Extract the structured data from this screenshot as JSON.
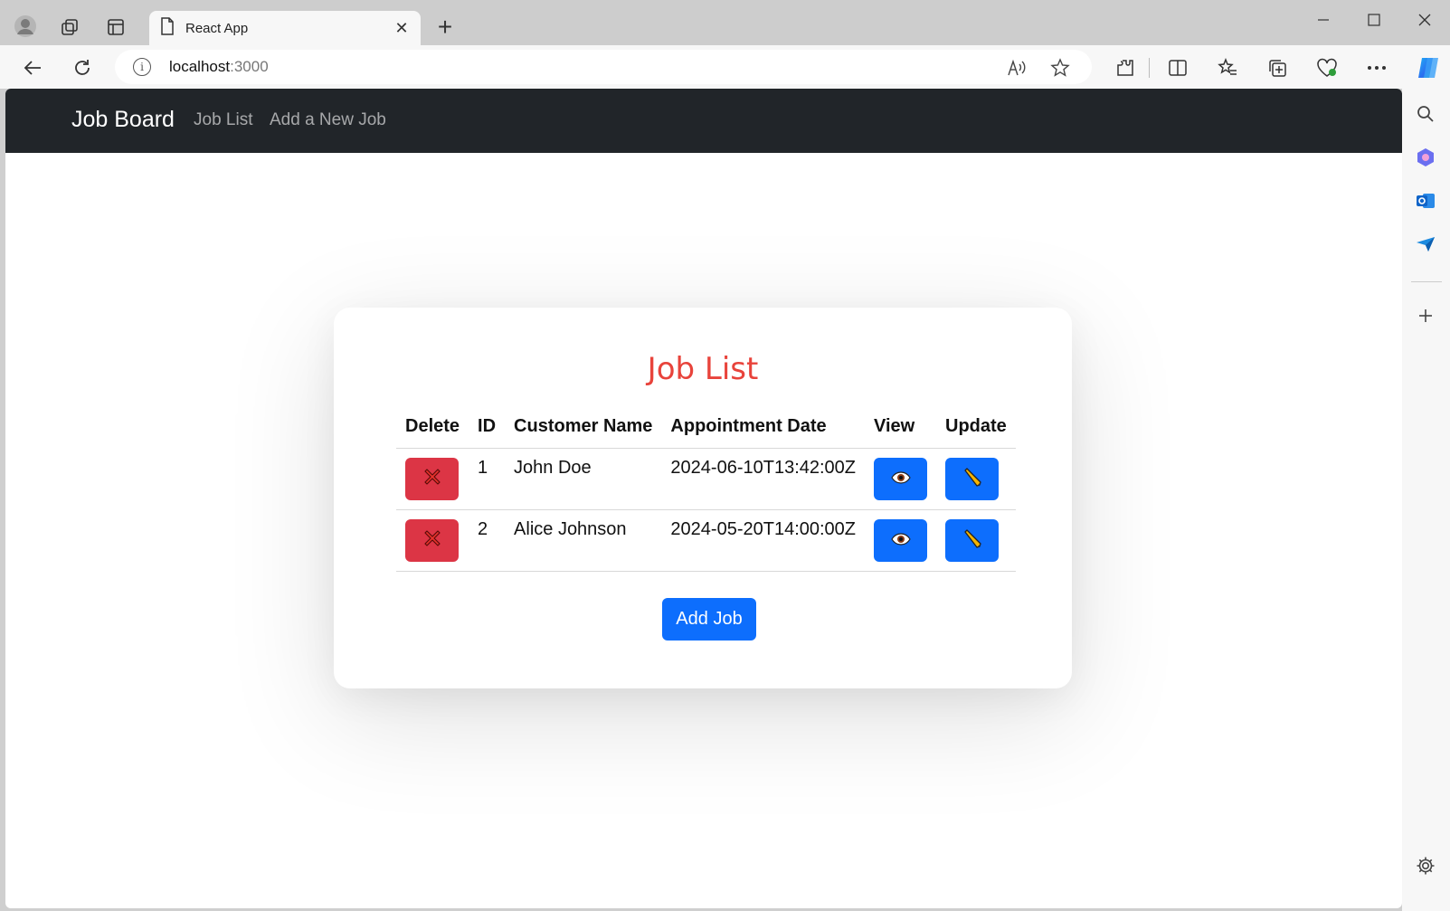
{
  "browser": {
    "tab_title": "React App",
    "address_host": "localhost",
    "address_port": ":3000",
    "tab_close": "✕",
    "new_tab": "+"
  },
  "navbar": {
    "brand": "Job Board",
    "links": [
      "Job List",
      "Add a New Job"
    ]
  },
  "card": {
    "title": "Job List",
    "title_color": "#e8433b",
    "columns": [
      "Delete",
      "ID",
      "Customer Name",
      "Appointment Date",
      "View",
      "Update"
    ],
    "rows": [
      {
        "id": "1",
        "customer_name": "John Doe",
        "appointment_date": "2024-06-10T13:42:00Z"
      },
      {
        "id": "2",
        "customer_name": "Alice Johnson",
        "appointment_date": "2024-05-20T14:00:00Z"
      }
    ],
    "add_button": "Add Job"
  },
  "colors": {
    "navbar_bg": "#212529",
    "danger": "#dc3545",
    "primary": "#0d6efd"
  },
  "icons": {
    "delete": "cross-mark-icon",
    "view": "eye-icon",
    "update": "pencil-icon"
  }
}
